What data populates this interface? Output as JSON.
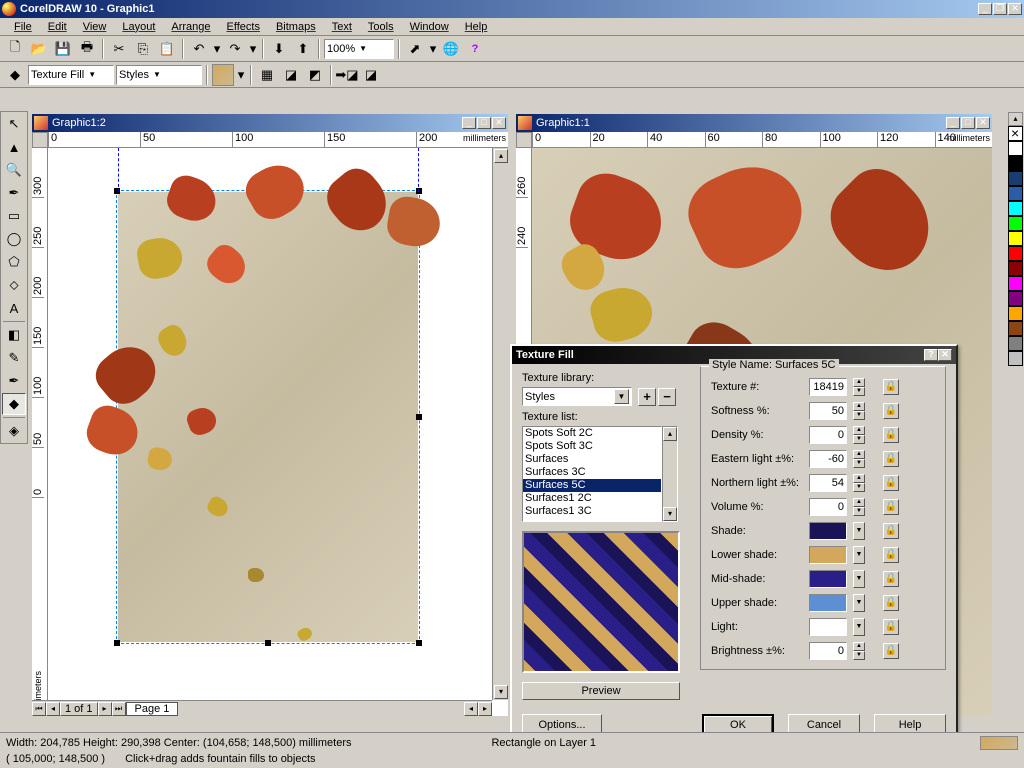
{
  "app": {
    "title": "CorelDRAW 10 - Graphic1"
  },
  "menu": [
    "File",
    "Edit",
    "View",
    "Layout",
    "Arrange",
    "Effects",
    "Bitmaps",
    "Text",
    "Tools",
    "Window",
    "Help"
  ],
  "toolbar1": {
    "zoom": "100%"
  },
  "toolbar2": {
    "fillType": "Texture Fill",
    "library": "Styles"
  },
  "doc1": {
    "title": "Graphic1:2",
    "hticks": [
      "0",
      "50",
      "100",
      "150",
      "200"
    ],
    "vticks": [
      "300",
      "250",
      "200",
      "150",
      "100",
      "50",
      "0"
    ],
    "ruler_unit": "millimeters",
    "page_label": "1 of 1",
    "tab": "Page 1"
  },
  "doc2": {
    "title": "Graphic1:1",
    "hticks": [
      "0",
      "20",
      "40",
      "60",
      "80",
      "100",
      "120",
      "140"
    ],
    "vticks": [
      "260",
      "240"
    ],
    "ruler_unit": "millimeters"
  },
  "dialog": {
    "title": "Texture Fill",
    "library_label": "Texture library:",
    "library_value": "Styles",
    "list_label": "Texture list:",
    "items": [
      "Spots Soft 2C",
      "Spots Soft 3C",
      "Surfaces",
      "Surfaces 3C",
      "Surfaces 5C",
      "Surfaces1 2C",
      "Surfaces1 3C"
    ],
    "selected": "Surfaces 5C",
    "preview_btn": "Preview",
    "options_btn": "Options...",
    "ok": "OK",
    "cancel": "Cancel",
    "help": "Help",
    "style_name_label": "Style Name: Surfaces 5C",
    "params": [
      {
        "label": "Texture #:",
        "value": "18419",
        "type": "num"
      },
      {
        "label": "Softness %:",
        "value": "50",
        "type": "num"
      },
      {
        "label": "Density %:",
        "value": "0",
        "type": "num"
      },
      {
        "label": "Eastern light ±%:",
        "value": "-60",
        "type": "num"
      },
      {
        "label": "Northern light ±%:",
        "value": "54",
        "type": "num"
      },
      {
        "label": "Volume %:",
        "value": "0",
        "type": "num"
      },
      {
        "label": "Shade:",
        "color": "#1a1358",
        "type": "color"
      },
      {
        "label": "Lower shade:",
        "color": "#d4a85c",
        "type": "color"
      },
      {
        "label": "Mid-shade:",
        "color": "#2a1f88",
        "type": "color"
      },
      {
        "label": "Upper shade:",
        "color": "#5c8fd4",
        "type": "color"
      },
      {
        "label": "Light:",
        "color": "#ffffff",
        "type": "color"
      },
      {
        "label": "Brightness ±%:",
        "value": "0",
        "type": "num"
      }
    ]
  },
  "colors": [
    "#ffffff",
    "#000000",
    "#1a3c6e",
    "#2a5da8",
    "#00ffff",
    "#00ff00",
    "#ffff00",
    "#ff0000",
    "#8b0000",
    "#ff00ff",
    "#800080",
    "#ffa500",
    "#8b4513",
    "#808080",
    "#c0c0c0"
  ],
  "status": {
    "line1a": "Width: 204,785 Height: 290,398 Center: (104,658; 148,500)  millimeters",
    "line1b": "Rectangle on Layer 1",
    "line2a": "( 105,000; 148,500 )",
    "line2b": "Click+drag adds fountain fills to objects"
  }
}
